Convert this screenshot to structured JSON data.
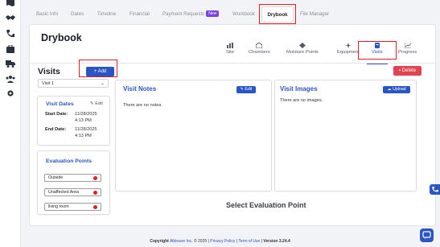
{
  "tabs": [
    {
      "label": "Basic Info"
    },
    {
      "label": "Dates"
    },
    {
      "label": "Timeline"
    },
    {
      "label": "Financial"
    },
    {
      "label": "Payment Requests",
      "badge": "New"
    },
    {
      "label": "Workbook"
    },
    {
      "label": "Drybook",
      "active": true
    },
    {
      "label": "File Manager"
    }
  ],
  "page": {
    "title": "Drybook"
  },
  "drybook_tabs": [
    {
      "label": "Site",
      "icon": "site-icon"
    },
    {
      "label": "Chambers",
      "icon": "chambers-icon"
    },
    {
      "label": "Moisture Points",
      "icon": "moisture-points-icon"
    },
    {
      "label": "Equipment",
      "icon": "equipment-icon"
    },
    {
      "label": "Visits",
      "icon": "visits-icon",
      "active": true
    },
    {
      "label": "Progress",
      "icon": "progress-icon"
    }
  ],
  "visits": {
    "title": "Visits",
    "add_label": "+ Add",
    "delete_label": "Delete",
    "selected_visit": "Visit 1"
  },
  "visit_dates": {
    "title": "Visit Dates",
    "edit_label": "Edit",
    "start_label": "Start Date:",
    "start_date": "11/28/2025",
    "start_time": "4:13 PM",
    "end_label": "End Date:",
    "end_date": "11/28/2025",
    "end_time": "4:13 PM"
  },
  "evaluation_points": {
    "title": "Evaluation Points",
    "items": [
      "Outside",
      "Unaffected Area",
      "living room"
    ]
  },
  "visit_notes": {
    "title": "Visit Notes",
    "edit_label": "Edit",
    "empty_text": "There are no notes."
  },
  "visit_images": {
    "title": "Visit Images",
    "upload_label": "Upload",
    "empty_text": "There are no images."
  },
  "select_eval_text": "Select Evaluation Point",
  "footer": {
    "copyright_label": "Copyright",
    "company": "Albiware Inc.",
    "year_text": "© 2025 |",
    "privacy": "Privacy Policy",
    "sep": "|",
    "terms": "Term of Use",
    "version_sep": "|",
    "version_label": "Version",
    "version": "3.24.4"
  },
  "colors": {
    "primary": "#2a55c4",
    "danger": "#e0454f",
    "highlight_box": "#e02020",
    "new_badge": "#7b3fe4"
  },
  "sidebar_icons": [
    "map-icon",
    "handshake-icon",
    "phone-icon",
    "briefcase-icon",
    "truck-icon",
    "team-icon",
    "gear-icon"
  ]
}
